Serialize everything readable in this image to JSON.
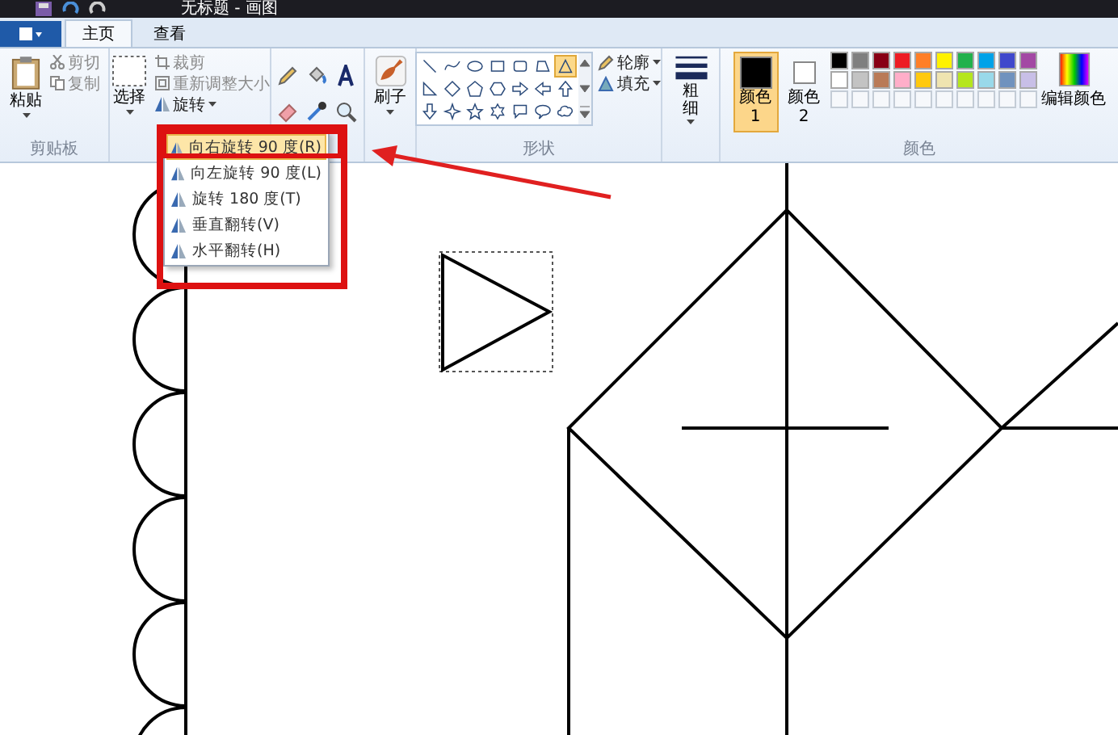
{
  "window": {
    "title": "无标题 - 画图"
  },
  "tabs": [
    {
      "label": "主页",
      "selected": true
    },
    {
      "label": "查看",
      "selected": false
    }
  ],
  "clipboard": {
    "paste": "粘贴",
    "cut": "剪切",
    "copy": "复制",
    "label": "剪贴板"
  },
  "image": {
    "select": "选择",
    "crop": "裁剪",
    "resize": "重新调整大小",
    "rotate": "旋转"
  },
  "brushes": {
    "label": "刷子"
  },
  "shapes": {
    "label": "形状",
    "outline": "轮廓",
    "fill": "填充",
    "gallery": [
      {
        "kind": "line",
        "selected": false
      },
      {
        "kind": "curve",
        "selected": false
      },
      {
        "kind": "oval",
        "selected": false
      },
      {
        "kind": "rect",
        "selected": false
      },
      {
        "kind": "roundrect",
        "selected": false
      },
      {
        "kind": "polygon",
        "selected": false
      },
      {
        "kind": "triangle",
        "selected": true
      },
      {
        "kind": "righttri",
        "selected": false
      },
      {
        "kind": "diamond",
        "selected": false
      },
      {
        "kind": "pentagon",
        "selected": false
      },
      {
        "kind": "hexagon",
        "selected": false
      },
      {
        "kind": "rightarrow",
        "selected": false
      },
      {
        "kind": "leftarrow",
        "selected": false
      },
      {
        "kind": "uparrow",
        "selected": false
      },
      {
        "kind": "downarrow",
        "selected": false
      },
      {
        "kind": "star4",
        "selected": false
      },
      {
        "kind": "star5",
        "selected": false
      },
      {
        "kind": "star6",
        "selected": false
      },
      {
        "kind": "callout",
        "selected": false
      },
      {
        "kind": "ovalcallout",
        "selected": false
      },
      {
        "kind": "cloud",
        "selected": false
      }
    ]
  },
  "size": {
    "label": "粗细"
  },
  "colors": {
    "label": "颜色",
    "edit": "编辑颜色",
    "current": [
      {
        "label": "颜色 1",
        "color": "#000000",
        "selected": true
      },
      {
        "label": "颜色 2",
        "color": "#ffffff",
        "selected": false
      }
    ],
    "palette": [
      {
        "color": "#000000"
      },
      {
        "color": "#7f7f7f"
      },
      {
        "color": "#880015"
      },
      {
        "color": "#ed1c24"
      },
      {
        "color": "#ff7f27"
      },
      {
        "color": "#fff200"
      },
      {
        "color": "#22b14c"
      },
      {
        "color": "#00a2e8"
      },
      {
        "color": "#3f48cc"
      },
      {
        "color": "#a349a4"
      },
      {
        "color": "#ffffff"
      },
      {
        "color": "#c3c3c3"
      },
      {
        "color": "#b97a57"
      },
      {
        "color": "#ffaec9"
      },
      {
        "color": "#ffc90e"
      },
      {
        "color": "#efe4b0"
      },
      {
        "color": "#b5e61d"
      },
      {
        "color": "#99d9ea"
      },
      {
        "color": "#7092be"
      },
      {
        "color": "#c8bfe7"
      }
    ]
  },
  "rotate_menu": {
    "items": [
      {
        "label": "向右旋转 90 度(R)",
        "selected": true
      },
      {
        "label": "向左旋转 90 度(L)",
        "selected": false
      },
      {
        "label": "旋转 180 度(T)",
        "selected": false
      },
      {
        "label": "垂直翻转(V)",
        "selected": false
      },
      {
        "label": "水平翻转(H)",
        "selected": false
      }
    ]
  }
}
